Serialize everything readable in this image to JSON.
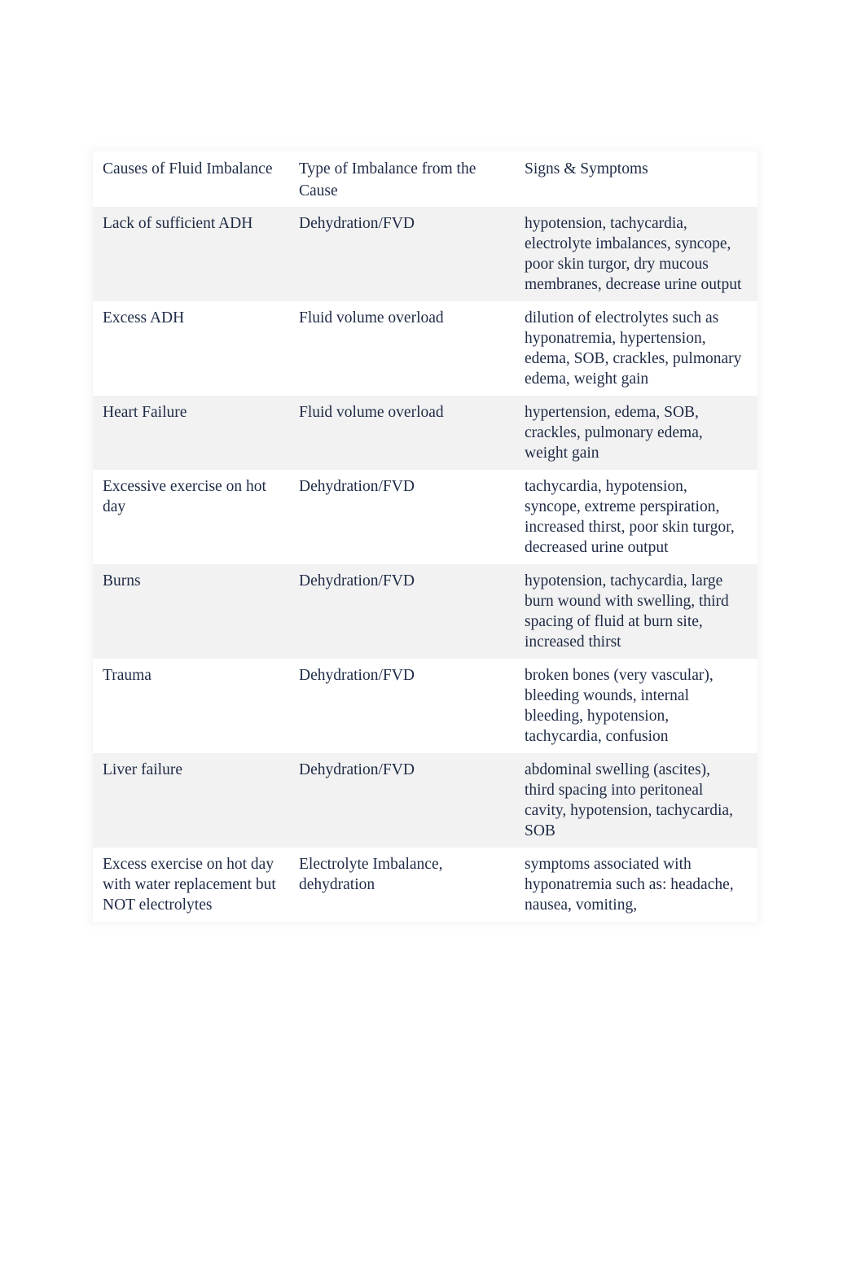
{
  "table": {
    "headers": [
      "Causes of Fluid Imbalance",
      "Type of Imbalance from the Cause",
      "Signs & Symptoms"
    ],
    "rows": [
      {
        "cause": "Lack of sufficient ADH",
        "type": "Dehydration/FVD",
        "signs": "hypotension, tachycardia, electrolyte imbalances, syncope, poor skin turgor, dry mucous membranes, decrease urine output"
      },
      {
        "cause": "Excess ADH",
        "type": "Fluid volume overload",
        "signs": "dilution of electrolytes such as hyponatremia, hypertension, edema, SOB, crackles, pulmonary edema, weight gain"
      },
      {
        "cause": "Heart Failure",
        "type": "Fluid volume overload",
        "signs": "hypertension, edema, SOB, crackles, pulmonary edema, weight gain"
      },
      {
        "cause": "Excessive exercise on hot day",
        "type": "Dehydration/FVD",
        "signs": "tachycardia, hypotension, syncope, extreme perspiration, increased thirst, poor skin turgor, decreased urine output"
      },
      {
        "cause": "Burns",
        "type": "Dehydration/FVD",
        "signs": "hypotension, tachycardia, large burn wound with swelling, third spacing of fluid at burn site, increased thirst"
      },
      {
        "cause": "Trauma",
        "type": "Dehydration/FVD",
        "signs": "broken bones (very vascular), bleeding wounds, internal bleeding, hypotension, tachycardia, confusion"
      },
      {
        "cause": "Liver failure",
        "type": "Dehydration/FVD",
        "signs": "abdominal swelling (ascites), third spacing into peritoneal cavity, hypotension, tachycardia, SOB"
      },
      {
        "cause": "Excess exercise on hot day with water replacement but NOT electrolytes",
        "type": "Electrolyte Imbalance, dehydration",
        "signs": "symptoms associated with hyponatremia such as: headache, nausea, vomiting,"
      }
    ]
  },
  "colors": {
    "text": "#1f2b46",
    "shaded_row": "#f2f2f2",
    "plain_row": "#ffffff"
  }
}
